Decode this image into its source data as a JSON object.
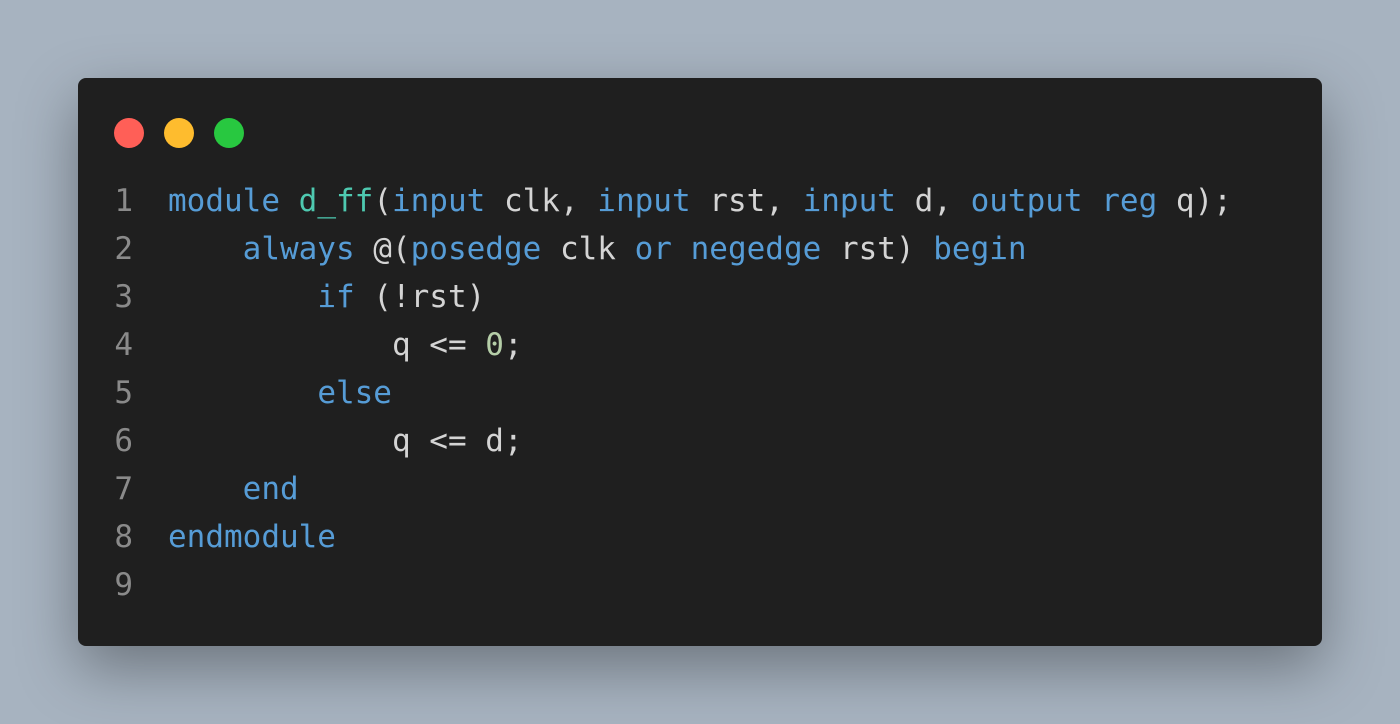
{
  "window": {
    "buttons": {
      "close": "close",
      "minimize": "minimize",
      "maximize": "maximize"
    }
  },
  "colors": {
    "background": "#a7b3c0",
    "window": "#1f1f1f",
    "keyword": "#569cd6",
    "function": "#4ec9b0",
    "number": "#b5cea8",
    "identifier": "#d4d4d4",
    "line_number": "#8a8a8a"
  },
  "code": {
    "lines": [
      {
        "number": "1",
        "tokens": [
          {
            "t": "module",
            "c": "kw"
          },
          {
            "t": " ",
            "c": "id"
          },
          {
            "t": "d_ff",
            "c": "fn"
          },
          {
            "t": "(",
            "c": "id"
          },
          {
            "t": "input",
            "c": "kw"
          },
          {
            "t": " clk, ",
            "c": "id"
          },
          {
            "t": "input",
            "c": "kw"
          },
          {
            "t": " rst, ",
            "c": "id"
          },
          {
            "t": "input",
            "c": "kw"
          },
          {
            "t": " d, ",
            "c": "id"
          },
          {
            "t": "output",
            "c": "kw"
          },
          {
            "t": " ",
            "c": "id"
          },
          {
            "t": "reg",
            "c": "kw"
          },
          {
            "t": " q);",
            "c": "id"
          }
        ]
      },
      {
        "number": "2",
        "tokens": [
          {
            "t": "    ",
            "c": "id"
          },
          {
            "t": "always",
            "c": "kw"
          },
          {
            "t": " @(",
            "c": "id"
          },
          {
            "t": "posedge",
            "c": "kw"
          },
          {
            "t": " clk ",
            "c": "id"
          },
          {
            "t": "or",
            "c": "kw"
          },
          {
            "t": " ",
            "c": "id"
          },
          {
            "t": "negedge",
            "c": "kw"
          },
          {
            "t": " rst) ",
            "c": "id"
          },
          {
            "t": "begin",
            "c": "kw"
          }
        ]
      },
      {
        "number": "3",
        "tokens": [
          {
            "t": "        ",
            "c": "id"
          },
          {
            "t": "if",
            "c": "kw"
          },
          {
            "t": " (!rst)",
            "c": "id"
          }
        ]
      },
      {
        "number": "4",
        "tokens": [
          {
            "t": "            q <= ",
            "c": "id"
          },
          {
            "t": "0",
            "c": "num"
          },
          {
            "t": ";",
            "c": "id"
          }
        ]
      },
      {
        "number": "5",
        "tokens": [
          {
            "t": "        ",
            "c": "id"
          },
          {
            "t": "else",
            "c": "kw"
          }
        ]
      },
      {
        "number": "6",
        "tokens": [
          {
            "t": "            q <= d;",
            "c": "id"
          }
        ]
      },
      {
        "number": "7",
        "tokens": [
          {
            "t": "    ",
            "c": "id"
          },
          {
            "t": "end",
            "c": "kw"
          }
        ]
      },
      {
        "number": "8",
        "tokens": [
          {
            "t": "endmodule",
            "c": "kw"
          }
        ]
      },
      {
        "number": "9",
        "tokens": []
      }
    ]
  }
}
